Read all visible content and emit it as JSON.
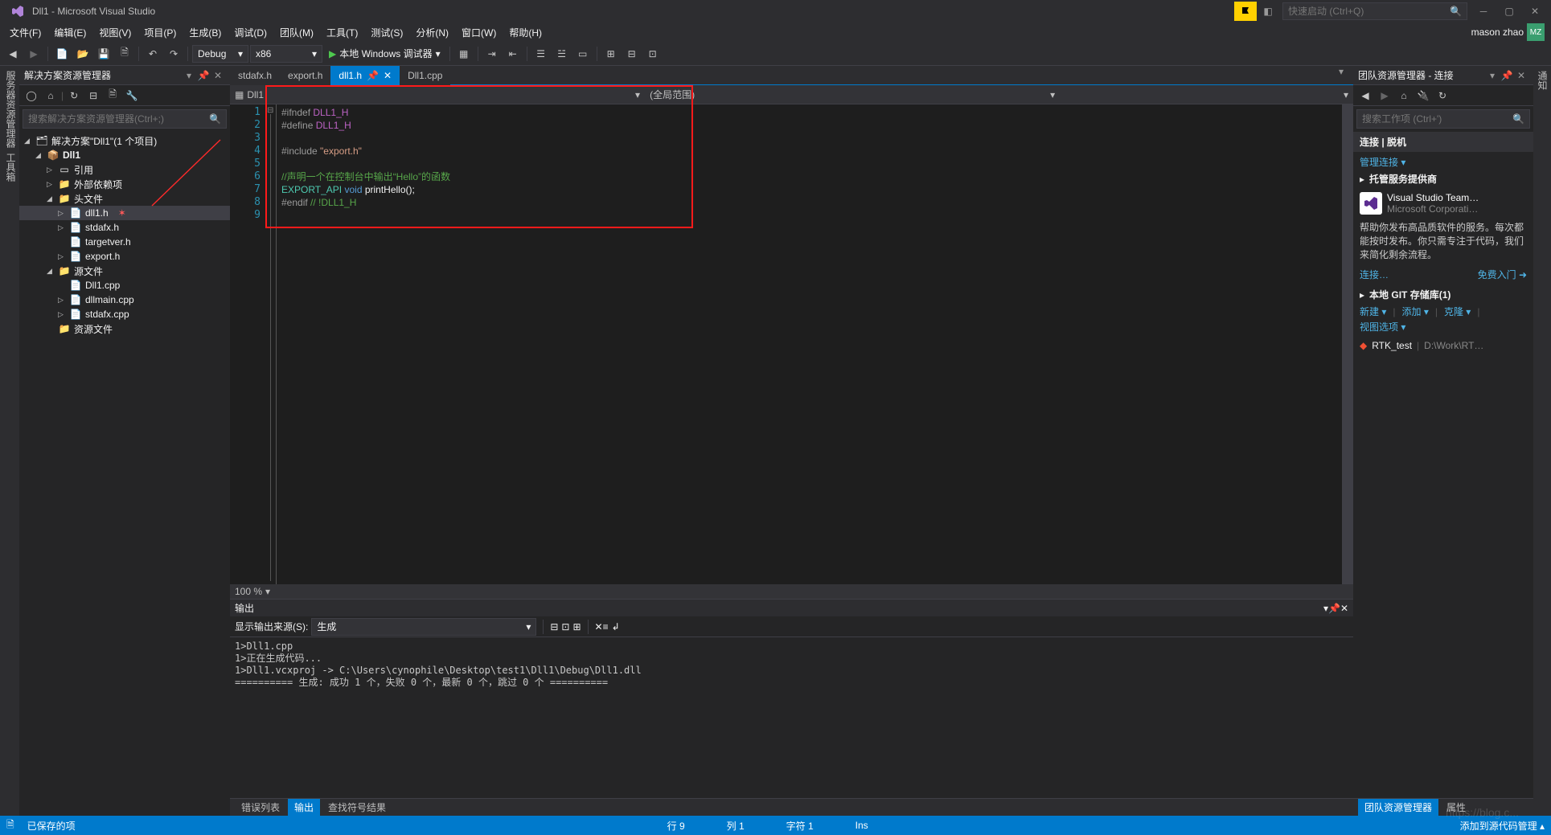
{
  "titlebar": {
    "title": "Dll1 - Microsoft Visual Studio",
    "quick_launch_placeholder": "快速启动 (Ctrl+Q)"
  },
  "menu": {
    "items": [
      "文件(F)",
      "编辑(E)",
      "视图(V)",
      "项目(P)",
      "生成(B)",
      "调试(D)",
      "团队(M)",
      "工具(T)",
      "测试(S)",
      "分析(N)",
      "窗口(W)",
      "帮助(H)"
    ],
    "user": "mason zhao",
    "avatar": "MZ"
  },
  "toolbar": {
    "config": "Debug",
    "platform": "x86",
    "start": "本地 Windows 调试器"
  },
  "left_strip": [
    "服务器资源管理器",
    "工具箱"
  ],
  "right_strip": [
    "通知"
  ],
  "solution": {
    "panel_title": "解决方案资源管理器",
    "search_placeholder": "搜索解决方案资源管理器(Ctrl+;)",
    "root": "解决方案\"Dll1\"(1 个项目)",
    "project": "Dll1",
    "refs": "引用",
    "ext_deps": "外部依赖项",
    "headers": "头文件",
    "header_files": [
      "dll1.h",
      "stdafx.h",
      "targetver.h",
      "export.h"
    ],
    "sources": "源文件",
    "source_files": [
      "Dll1.cpp",
      "dllmain.cpp",
      "stdafx.cpp"
    ],
    "resources": "资源文件"
  },
  "tabs": [
    {
      "label": "stdafx.h",
      "active": false
    },
    {
      "label": "export.h",
      "active": false
    },
    {
      "label": "dll1.h",
      "active": true,
      "pinned": true
    },
    {
      "label": "Dll1.cpp",
      "active": false
    }
  ],
  "docnav": {
    "left": "Dll1",
    "right": "(全局范围)"
  },
  "code": {
    "lines": [
      {
        "n": 1,
        "tokens": [
          [
            "kw-pp",
            "#ifndef "
          ],
          [
            "kw-macro",
            "DLL1_H"
          ]
        ]
      },
      {
        "n": 2,
        "tokens": [
          [
            "kw-pp",
            "#define "
          ],
          [
            "kw-macro",
            "DLL1_H"
          ]
        ]
      },
      {
        "n": 3,
        "tokens": []
      },
      {
        "n": 4,
        "tokens": [
          [
            "kw-pp",
            "#include "
          ],
          [
            "kw-str",
            "\"export.h\""
          ]
        ]
      },
      {
        "n": 5,
        "tokens": []
      },
      {
        "n": 6,
        "tokens": [
          [
            "kw-cmt",
            "//声明一个在控制台中输出“Hello”的函数"
          ]
        ]
      },
      {
        "n": 7,
        "tokens": [
          [
            "kw-exp",
            "EXPORT_API "
          ],
          [
            "kw-type",
            "void"
          ],
          [
            "",
            " printHello();"
          ]
        ]
      },
      {
        "n": 8,
        "tokens": [
          [
            "kw-pp",
            "#endif "
          ],
          [
            "kw-cmt",
            "// !DLL1_H"
          ]
        ]
      },
      {
        "n": 9,
        "tokens": []
      }
    ],
    "zoom": "100 %"
  },
  "output": {
    "panel_title": "输出",
    "source_label": "显示输出来源(S):",
    "source_value": "生成",
    "lines": [
      "1>Dll1.cpp",
      "1>正在生成代码...",
      "1>Dll1.vcxproj -> C:\\Users\\cynophile\\Desktop\\test1\\Dll1\\Debug\\Dll1.dll",
      "========== 生成: 成功 1 个，失败 0 个，最新 0 个，跳过 0 个 =========="
    ]
  },
  "bottom_tabs": [
    "错误列表",
    "输出",
    "查找符号结果"
  ],
  "team": {
    "panel_title": "团队资源管理器 - 连接",
    "search_placeholder": "搜索工作项 (Ctrl+')",
    "section_connect": "连接 | 脱机",
    "manage": "管理连接 ▾",
    "hosted_title": "托管服务提供商",
    "vs_team": "Visual Studio Team…",
    "ms_corp": "Microsoft Corporati…",
    "desc1": "帮助你发布高品质软件的服务。每次都能按时发布。你只需专注于代码，我们来简化剩余流程。",
    "connect_link": "连接…",
    "free_link": "免费入门",
    "git_title": "本地 GIT 存储库(1)",
    "git_actions": [
      "新建 ▾",
      "添加 ▾",
      "克隆 ▾",
      "视图选项 ▾"
    ],
    "repo_name": "RTK_test",
    "repo_path": "D:\\Work\\RT…"
  },
  "bottom_tabs_r": [
    "团队资源管理器",
    "属性"
  ],
  "status": {
    "saved": "已保存的项",
    "line": "行 9",
    "col": "列 1",
    "char": "字符 1",
    "ins": "Ins",
    "scm": "添加到源代码管理 ▴"
  },
  "watermark": "https://blog.c..."
}
